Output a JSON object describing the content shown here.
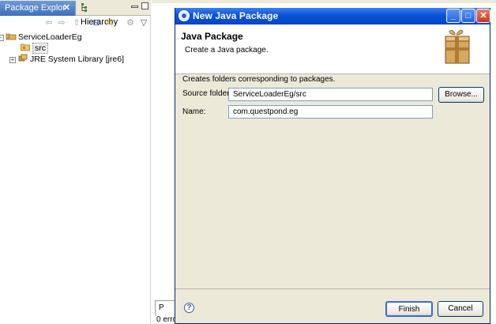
{
  "left_pane": {
    "tabs": [
      {
        "label": "Package Explor",
        "close_glyph": "✕"
      },
      {
        "label": "Hierarchy"
      }
    ],
    "toolbar_icons": [
      "back-arrow-icon",
      "forward-arrow-icon",
      "up-folder-icon",
      "collapse-all-icon",
      "link-editor-icon",
      "view-menu-icon",
      "dropdown-icon"
    ],
    "tree": {
      "project": {
        "label": "ServiceLoaderEg",
        "expander": "-"
      },
      "items": [
        {
          "label": "src"
        },
        {
          "label": "JRE System Library [jre6]",
          "expander": "+"
        }
      ]
    }
  },
  "editor_area": {
    "bottom_tab_label": "P",
    "bottom_status": "0 erro"
  },
  "dialog": {
    "title": "New Java Package",
    "caption_buttons": {
      "minimize": "_",
      "maximize": "□",
      "close": "✕"
    },
    "heading": "Java Package",
    "description": "Create a Java package.",
    "info": "Creates folders corresponding to packages.",
    "source_folder": {
      "label": "Source folder:",
      "value": "ServiceLoaderEg/src"
    },
    "name": {
      "label": "Name:",
      "value": "com.questpond.eg"
    },
    "browse_label": "Browse...",
    "finish_label": "Finish",
    "cancel_label": "Cancel",
    "help_glyph": "?"
  },
  "colors": {
    "title_bar": "#0a52d6",
    "dialog_bg": "#ece9d8",
    "active_tab": "#3f6fb8"
  }
}
